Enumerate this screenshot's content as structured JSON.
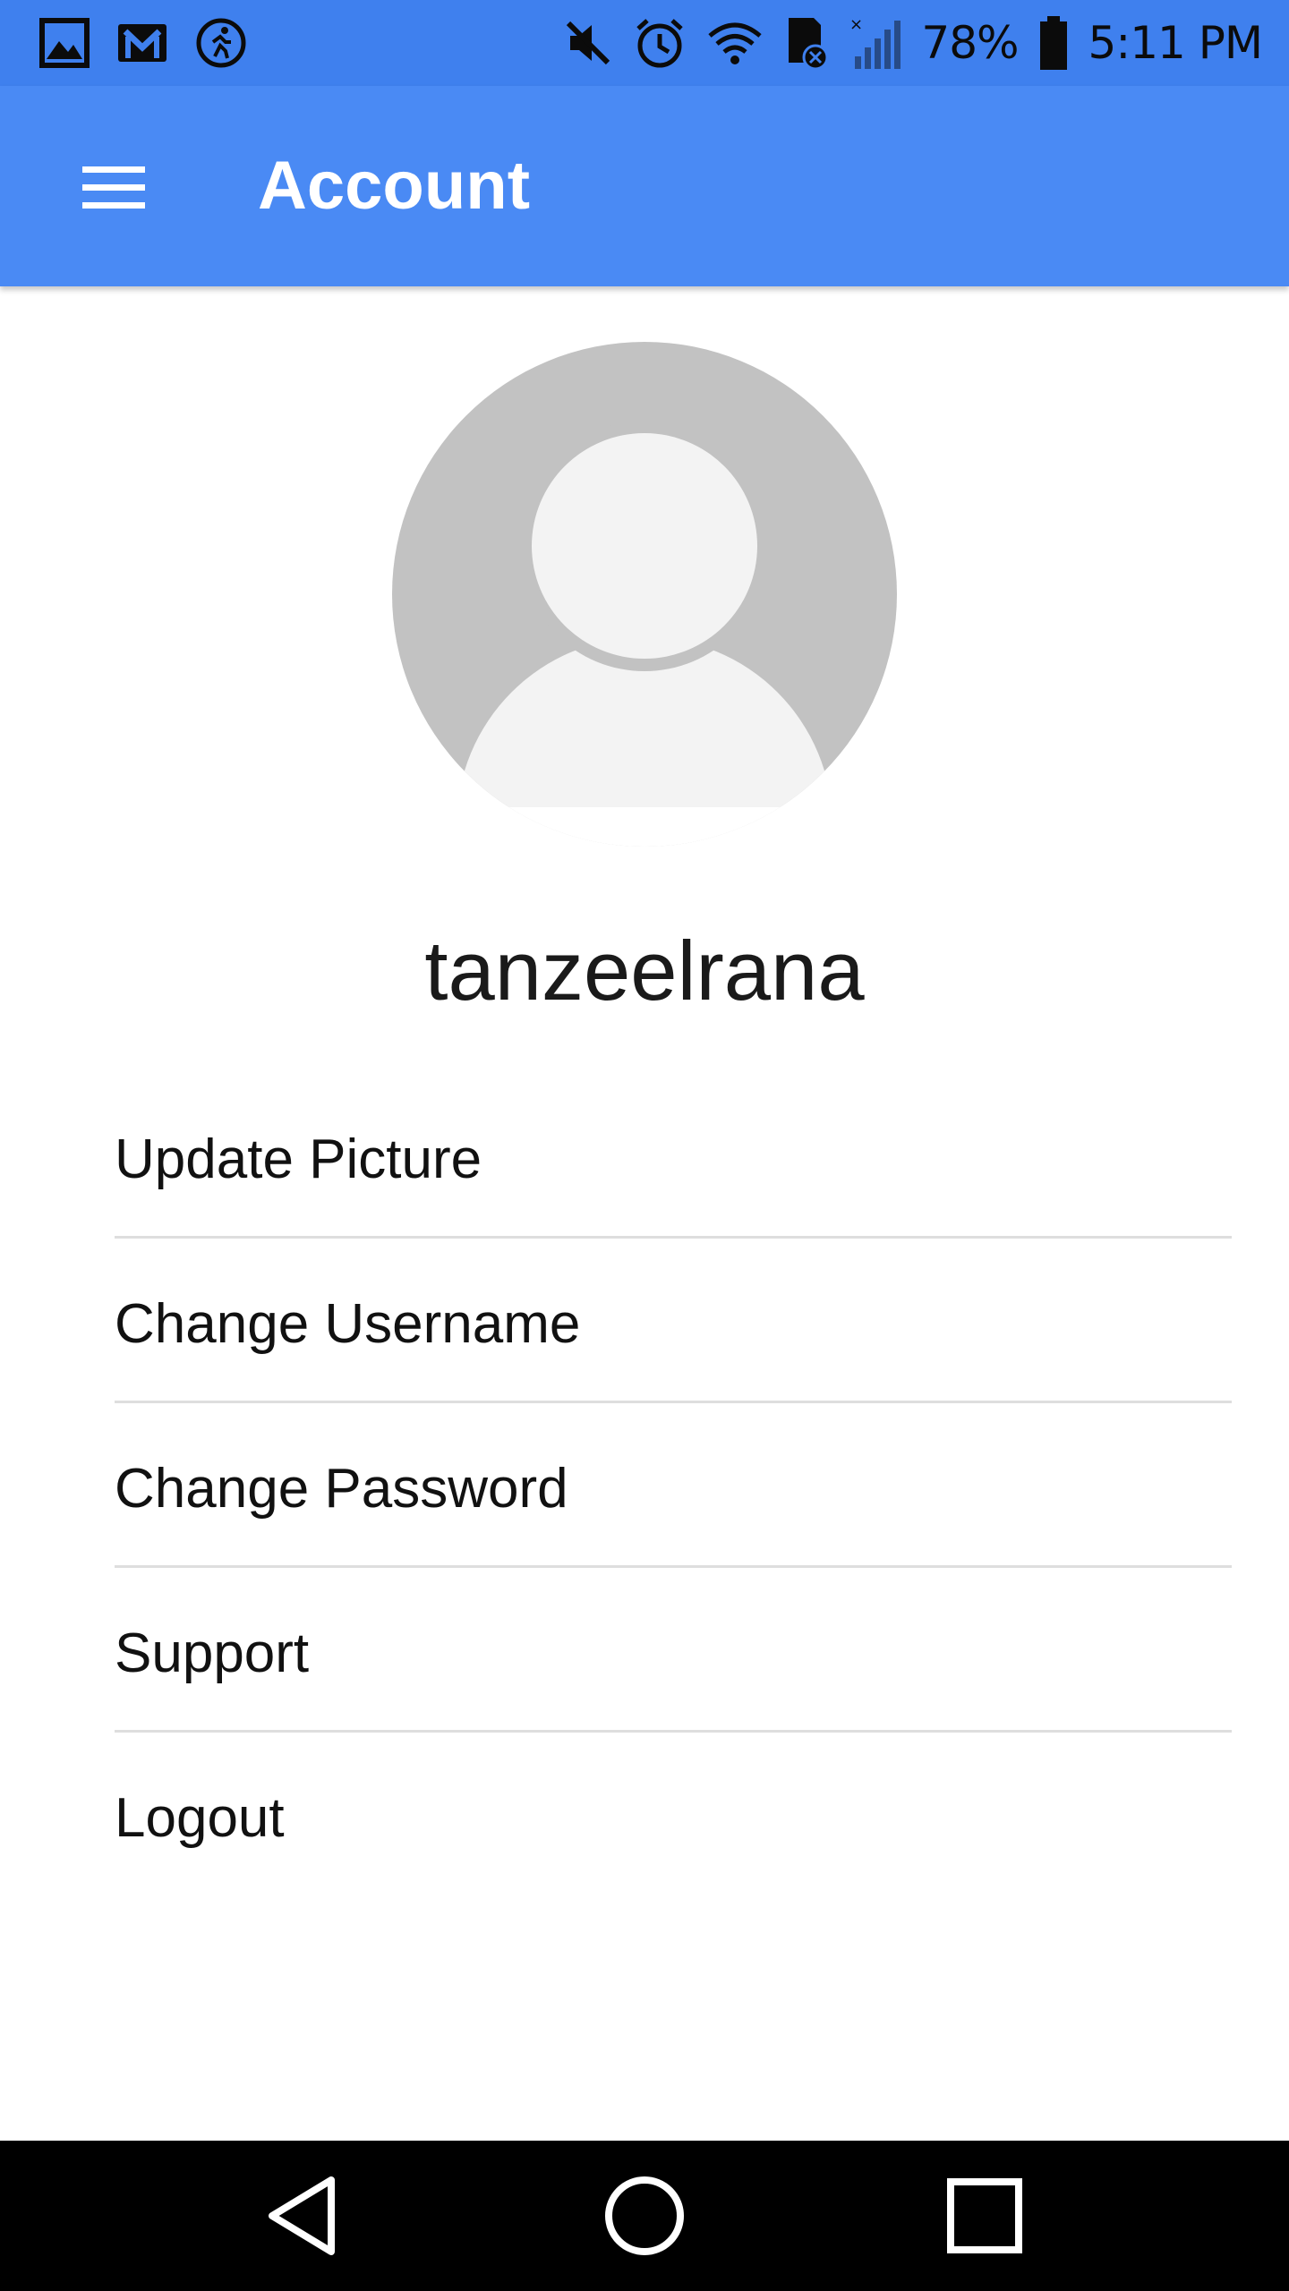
{
  "status_bar": {
    "left_icons": [
      "gallery-icon",
      "gmail-icon",
      "fitness-activity-icon"
    ],
    "right_icons": [
      "mute-icon",
      "alarm-icon",
      "wifi-icon",
      "sd-card-error-icon",
      "cell-signal-icon",
      "battery-icon"
    ],
    "battery_percent": "78%",
    "time": "5:11 PM"
  },
  "app_bar": {
    "title": "Account",
    "menu_icon": "hamburger-menu-icon",
    "background": "#4a8af4"
  },
  "profile": {
    "avatar_icon": "default-avatar-icon",
    "username": "tanzeelrana"
  },
  "menu": {
    "items": [
      {
        "label": "Update Picture"
      },
      {
        "label": "Change Username"
      },
      {
        "label": "Change Password"
      },
      {
        "label": "Support"
      },
      {
        "label": "Logout"
      }
    ]
  },
  "nav_bar": {
    "buttons": [
      "back-icon",
      "home-icon",
      "recents-icon"
    ]
  }
}
